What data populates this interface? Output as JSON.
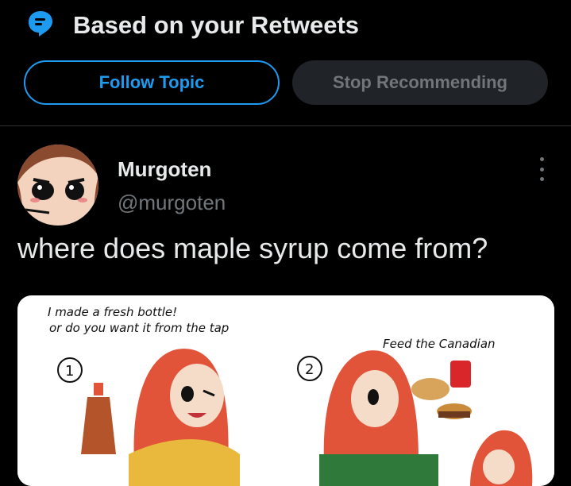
{
  "topic_header": {
    "icon": "topic-bubble-icon",
    "title": "Based on your Retweets"
  },
  "buttons": {
    "follow_label": "Follow Topic",
    "stop_label": "Stop Recommending"
  },
  "tweet": {
    "author_name": "Murgoten",
    "author_handle": "@murgoten",
    "text": "where does maple syrup come from?",
    "more_icon": "more-vertical-icon"
  },
  "comic": {
    "line1": "I made a fresh bottle!",
    "line2": "or do you want it from the tap",
    "line3": "Feed the Canadian",
    "panel1": "1",
    "panel2": "2"
  },
  "colors": {
    "accent": "#1d9bf0",
    "background": "#000000",
    "muted": "#71767b",
    "text": "#e7e9ea"
  }
}
